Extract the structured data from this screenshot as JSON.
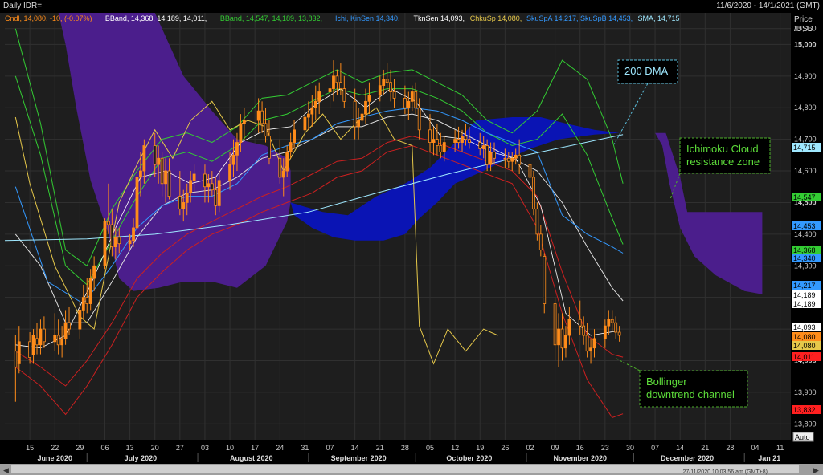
{
  "header": {
    "title": "Daily IDR=",
    "date_range": "11/6/2020 - 14/1/2021 (GMT)"
  },
  "legend": [
    {
      "text": "Cndl, 14,080, -10, (-0.07%)",
      "color": "#ff8c1a"
    },
    {
      "text": "BBand, 14,368, 14,189, 14,011, ",
      "color": "#ffffff"
    },
    {
      "text": "BBand, 14,547, 14,189, 13,832, ",
      "color": "#33cc33"
    },
    {
      "text": "Ichi, KinSen 14,340, ",
      "color": "#3399ff"
    },
    {
      "text": "TknSen 14,093, ",
      "color": "#ffffff"
    },
    {
      "text": "ChkuSp 14,080, ",
      "color": "#e6c84a"
    },
    {
      "text": "SkuSpA 14,217, SkuSpB 14,453, ",
      "color": "#3399ff"
    },
    {
      "text": "SMA, 14,715",
      "color": "#9fe8ff"
    }
  ],
  "price_axis": {
    "title_line1": "Price",
    "title_line2": "/USD",
    "auto_label": "Auto"
  },
  "footer": {
    "timestamp": "27/11/2020 10:03:56 am (GMT+8)"
  },
  "annotations": [
    {
      "text_lines": [
        "200 DMA"
      ],
      "color": "#9fe8ff",
      "border": "#5bc0de"
    },
    {
      "text_lines": [
        "Ichimoku Cloud",
        "resistance zone"
      ],
      "color": "#5ddc3a",
      "border": "#4caf2a"
    },
    {
      "text_lines": [
        "Bollinger",
        "downtrend channel"
      ],
      "color": "#5ddc3a",
      "border": "#4caf2a"
    }
  ],
  "chart_data": {
    "type": "candlestick",
    "title": "Daily IDR=",
    "ylim": [
      13750,
      15100
    ],
    "ylabel": "Price /USD",
    "y_ticks": [
      13800,
      13900,
      14000,
      14100,
      14200,
      14300,
      14400,
      14500,
      14600,
      14700,
      14800,
      14900,
      15000,
      15050
    ],
    "y_tick_labels": [
      "13,800",
      "13,900",
      "14,000",
      "14,100",
      "14,200",
      "14,300",
      "14,400",
      "14,500",
      "14,600",
      "14,700",
      "14,800",
      "14,900",
      "15,000",
      "15,050"
    ],
    "y_bold_ticks": [
      14000,
      14500,
      15000
    ],
    "x_day_labels": [
      "15",
      "22",
      "29",
      "06",
      "13",
      "20",
      "27",
      "03",
      "10",
      "17",
      "24",
      "31",
      "07",
      "14",
      "21",
      "28",
      "05",
      "12",
      "19",
      "26",
      "02",
      "09",
      "16",
      "23",
      "30",
      "07",
      "14",
      "21",
      "28",
      "04",
      "11"
    ],
    "x_month_labels": [
      "June 2020",
      "July 2020",
      "August 2020",
      "September 2020",
      "October 2020",
      "November 2020",
      "December 2020",
      "Jan 21"
    ],
    "last_values": [
      {
        "label": "14,715",
        "value": 14715,
        "bg": "#9fe8ff",
        "fg": "#000000"
      },
      {
        "label": "14,547",
        "value": 14547,
        "bg": "#33cc33",
        "fg": "#000000"
      },
      {
        "label": "14,453",
        "value": 14453,
        "bg": "#3399ff",
        "fg": "#000000"
      },
      {
        "label": "14,368",
        "value": 14368,
        "bg": "#33cc33",
        "fg": "#000000"
      },
      {
        "label": "14,340",
        "value": 14340,
        "bg": "#3399ff",
        "fg": "#000000"
      },
      {
        "label": "14,217",
        "value": 14217,
        "bg": "#3399ff",
        "fg": "#000000"
      },
      {
        "label": "14,189",
        "value": 14189,
        "bg": "#ffffff",
        "fg": "#000000"
      },
      {
        "label": "14,189",
        "value": 14189,
        "bg": "#ffffff",
        "fg": "#000000"
      },
      {
        "label": "14,093",
        "value": 14093,
        "bg": "#ffffff",
        "fg": "#000000"
      },
      {
        "label": "14,080",
        "value": 14080,
        "bg": "#ff8c1a",
        "fg": "#000000"
      },
      {
        "label": "14,080",
        "value": 14080,
        "bg": "#e6c84a",
        "fg": "#000000"
      },
      {
        "label": "14,011",
        "value": 14011,
        "bg": "#ff2020",
        "fg": "#000000"
      },
      {
        "label": "13,832",
        "value": 13832,
        "bg": "#ff2020",
        "fg": "#000000"
      }
    ],
    "candles": [
      {
        "date": "2020-06-11",
        "o": 14030,
        "h": 14080,
        "l": 13870,
        "c": 13980
      },
      {
        "date": "2020-06-12",
        "o": 13990,
        "h": 14110,
        "l": 13960,
        "c": 14060
      },
      {
        "date": "2020-06-15",
        "o": 14060,
        "h": 14090,
        "l": 13990,
        "c": 14010
      },
      {
        "date": "2020-06-16",
        "o": 14020,
        "h": 14100,
        "l": 13990,
        "c": 14080
      },
      {
        "date": "2020-06-17",
        "o": 14070,
        "h": 14120,
        "l": 14020,
        "c": 14050
      },
      {
        "date": "2020-06-18",
        "o": 14050,
        "h": 14130,
        "l": 14020,
        "c": 14100
      },
      {
        "date": "2020-06-19",
        "o": 14100,
        "h": 14140,
        "l": 14040,
        "c": 14060
      },
      {
        "date": "2020-06-22",
        "o": 14060,
        "h": 14150,
        "l": 14030,
        "c": 14080
      },
      {
        "date": "2020-06-23",
        "o": 14080,
        "h": 14130,
        "l": 14020,
        "c": 14050
      },
      {
        "date": "2020-06-24",
        "o": 14050,
        "h": 14110,
        "l": 14010,
        "c": 14070
      },
      {
        "date": "2020-06-25",
        "o": 14070,
        "h": 14160,
        "l": 14050,
        "c": 14120
      },
      {
        "date": "2020-06-26",
        "o": 14120,
        "h": 14170,
        "l": 14080,
        "c": 14100
      },
      {
        "date": "2020-06-29",
        "o": 14100,
        "h": 14190,
        "l": 14070,
        "c": 14160
      },
      {
        "date": "2020-06-30",
        "o": 14160,
        "h": 14240,
        "l": 14130,
        "c": 14200
      },
      {
        "date": "2020-07-01",
        "o": 14200,
        "h": 14260,
        "l": 14150,
        "c": 14180
      },
      {
        "date": "2020-07-02",
        "o": 14180,
        "h": 14290,
        "l": 14160,
        "c": 14260
      },
      {
        "date": "2020-07-03",
        "o": 14260,
        "h": 14330,
        "l": 14220,
        "c": 14300
      },
      {
        "date": "2020-07-06",
        "o": 14300,
        "h": 14450,
        "l": 14290,
        "c": 14440
      },
      {
        "date": "2020-07-07",
        "o": 14440,
        "h": 14560,
        "l": 14400,
        "c": 14430
      },
      {
        "date": "2020-07-08",
        "o": 14430,
        "h": 14480,
        "l": 14330,
        "c": 14360
      },
      {
        "date": "2020-07-09",
        "o": 14360,
        "h": 14420,
        "l": 14320,
        "c": 14390
      },
      {
        "date": "2020-07-10",
        "o": 14390,
        "h": 14420,
        "l": 14340,
        "c": 14370
      },
      {
        "date": "2020-07-13",
        "o": 14370,
        "h": 14400,
        "l": 14350,
        "c": 14380
      },
      {
        "date": "2020-07-14",
        "o": 14380,
        "h": 14450,
        "l": 14360,
        "c": 14420
      },
      {
        "date": "2020-07-15",
        "o": 14420,
        "h": 14600,
        "l": 14400,
        "c": 14580
      },
      {
        "date": "2020-07-16",
        "o": 14580,
        "h": 14660,
        "l": 14520,
        "c": 14600
      },
      {
        "date": "2020-07-17",
        "o": 14600,
        "h": 14700,
        "l": 14560,
        "c": 14680
      },
      {
        "date": "2020-07-20",
        "o": 14680,
        "h": 14720,
        "l": 14580,
        "c": 14620
      },
      {
        "date": "2020-07-21",
        "o": 14620,
        "h": 14680,
        "l": 14560,
        "c": 14640
      },
      {
        "date": "2020-07-22",
        "o": 14640,
        "h": 14660,
        "l": 14520,
        "c": 14560
      },
      {
        "date": "2020-07-23",
        "o": 14560,
        "h": 14640,
        "l": 14500,
        "c": 14600
      },
      {
        "date": "2020-07-24",
        "o": 14600,
        "h": 14640,
        "l": 14510,
        "c": 14520
      },
      {
        "date": "2020-07-27",
        "o": 14520,
        "h": 14600,
        "l": 14460,
        "c": 14480
      },
      {
        "date": "2020-07-28",
        "o": 14480,
        "h": 14540,
        "l": 14440,
        "c": 14500
      },
      {
        "date": "2020-07-29",
        "o": 14500,
        "h": 14560,
        "l": 14460,
        "c": 14530
      },
      {
        "date": "2020-07-30",
        "o": 14530,
        "h": 14600,
        "l": 14500,
        "c": 14570
      },
      {
        "date": "2020-07-31",
        "o": 14570,
        "h": 14620,
        "l": 14530,
        "c": 14590
      },
      {
        "date": "2020-08-03",
        "o": 14590,
        "h": 14620,
        "l": 14500,
        "c": 14550
      },
      {
        "date": "2020-08-04",
        "o": 14550,
        "h": 14590,
        "l": 14500,
        "c": 14560
      },
      {
        "date": "2020-08-05",
        "o": 14560,
        "h": 14600,
        "l": 14520,
        "c": 14540
      },
      {
        "date": "2020-08-06",
        "o": 14540,
        "h": 14580,
        "l": 14460,
        "c": 14490
      },
      {
        "date": "2020-08-07",
        "o": 14490,
        "h": 14600,
        "l": 14470,
        "c": 14570
      },
      {
        "date": "2020-08-10",
        "o": 14570,
        "h": 14660,
        "l": 14540,
        "c": 14620
      },
      {
        "date": "2020-08-11",
        "o": 14620,
        "h": 14700,
        "l": 14580,
        "c": 14650
      },
      {
        "date": "2020-08-12",
        "o": 14650,
        "h": 14720,
        "l": 14600,
        "c": 14690
      },
      {
        "date": "2020-08-13",
        "o": 14690,
        "h": 14780,
        "l": 14660,
        "c": 14750
      },
      {
        "date": "2020-08-14",
        "o": 14750,
        "h": 14800,
        "l": 14700,
        "c": 14760
      },
      {
        "date": "2020-08-18",
        "o": 14760,
        "h": 14830,
        "l": 14720,
        "c": 14790
      },
      {
        "date": "2020-08-19",
        "o": 14790,
        "h": 14820,
        "l": 14720,
        "c": 14750
      },
      {
        "date": "2020-08-20",
        "o": 14750,
        "h": 14800,
        "l": 14690,
        "c": 14710
      },
      {
        "date": "2020-08-21",
        "o": 14710,
        "h": 14760,
        "l": 14620,
        "c": 14640
      },
      {
        "date": "2020-08-24",
        "o": 14640,
        "h": 14700,
        "l": 14560,
        "c": 14580
      },
      {
        "date": "2020-08-25",
        "o": 14580,
        "h": 14640,
        "l": 14520,
        "c": 14600
      },
      {
        "date": "2020-08-26",
        "o": 14600,
        "h": 14680,
        "l": 14580,
        "c": 14660
      },
      {
        "date": "2020-08-27",
        "o": 14660,
        "h": 14720,
        "l": 14640,
        "c": 14690
      },
      {
        "date": "2020-08-28",
        "o": 14690,
        "h": 14760,
        "l": 14670,
        "c": 14730
      },
      {
        "date": "2020-08-31",
        "o": 14730,
        "h": 14800,
        "l": 14700,
        "c": 14770
      },
      {
        "date": "2020-09-01",
        "o": 14770,
        "h": 14820,
        "l": 14730,
        "c": 14780
      },
      {
        "date": "2020-09-02",
        "o": 14780,
        "h": 14840,
        "l": 14740,
        "c": 14800
      },
      {
        "date": "2020-09-03",
        "o": 14800,
        "h": 14870,
        "l": 14760,
        "c": 14820
      },
      {
        "date": "2020-09-04",
        "o": 14820,
        "h": 14880,
        "l": 14780,
        "c": 14850
      },
      {
        "date": "2020-09-07",
        "o": 14850,
        "h": 14900,
        "l": 14800,
        "c": 14860
      },
      {
        "date": "2020-09-08",
        "o": 14860,
        "h": 14950,
        "l": 14820,
        "c": 14900
      },
      {
        "date": "2020-09-09",
        "o": 14900,
        "h": 14920,
        "l": 14840,
        "c": 14880
      },
      {
        "date": "2020-09-10",
        "o": 14880,
        "h": 14940,
        "l": 14840,
        "c": 14860
      },
      {
        "date": "2020-09-11",
        "o": 14860,
        "h": 14900,
        "l": 14800,
        "c": 14820
      },
      {
        "date": "2020-09-14",
        "o": 14820,
        "h": 14860,
        "l": 14700,
        "c": 14740
      },
      {
        "date": "2020-09-15",
        "o": 14740,
        "h": 14800,
        "l": 14700,
        "c": 14760
      },
      {
        "date": "2020-09-16",
        "o": 14760,
        "h": 14820,
        "l": 14730,
        "c": 14780
      },
      {
        "date": "2020-09-17",
        "o": 14780,
        "h": 14860,
        "l": 14750,
        "c": 14820
      },
      {
        "date": "2020-09-18",
        "o": 14820,
        "h": 14880,
        "l": 14780,
        "c": 14840
      },
      {
        "date": "2020-09-21",
        "o": 14840,
        "h": 14900,
        "l": 14820,
        "c": 14870
      },
      {
        "date": "2020-09-22",
        "o": 14870,
        "h": 14920,
        "l": 14840,
        "c": 14890
      },
      {
        "date": "2020-09-23",
        "o": 14890,
        "h": 14940,
        "l": 14850,
        "c": 14880
      },
      {
        "date": "2020-09-24",
        "o": 14880,
        "h": 14920,
        "l": 14820,
        "c": 14850
      },
      {
        "date": "2020-09-25",
        "o": 14850,
        "h": 14890,
        "l": 14800,
        "c": 14830
      },
      {
        "date": "2020-09-28",
        "o": 14830,
        "h": 14870,
        "l": 14780,
        "c": 14800
      },
      {
        "date": "2020-09-29",
        "o": 14800,
        "h": 14850,
        "l": 14760,
        "c": 14820
      },
      {
        "date": "2020-09-30",
        "o": 14820,
        "h": 14870,
        "l": 14790,
        "c": 14850
      },
      {
        "date": "2020-10-01",
        "o": 14850,
        "h": 14880,
        "l": 14780,
        "c": 14800
      },
      {
        "date": "2020-10-02",
        "o": 14800,
        "h": 14830,
        "l": 14700,
        "c": 14730
      },
      {
        "date": "2020-10-05",
        "o": 14730,
        "h": 14780,
        "l": 14660,
        "c": 14690
      },
      {
        "date": "2020-10-06",
        "o": 14690,
        "h": 14740,
        "l": 14650,
        "c": 14700
      },
      {
        "date": "2020-10-07",
        "o": 14700,
        "h": 14750,
        "l": 14650,
        "c": 14680
      },
      {
        "date": "2020-10-08",
        "o": 14680,
        "h": 14720,
        "l": 14640,
        "c": 14660
      },
      {
        "date": "2020-10-09",
        "o": 14660,
        "h": 14710,
        "l": 14630,
        "c": 14690
      },
      {
        "date": "2020-10-12",
        "o": 14690,
        "h": 14730,
        "l": 14660,
        "c": 14700
      },
      {
        "date": "2020-10-13",
        "o": 14700,
        "h": 14740,
        "l": 14670,
        "c": 14690
      },
      {
        "date": "2020-10-14",
        "o": 14690,
        "h": 14730,
        "l": 14660,
        "c": 14710
      },
      {
        "date": "2020-10-15",
        "o": 14710,
        "h": 14750,
        "l": 14680,
        "c": 14700
      },
      {
        "date": "2020-10-16",
        "o": 14700,
        "h": 14740,
        "l": 14670,
        "c": 14690
      },
      {
        "date": "2020-10-19",
        "o": 14690,
        "h": 14720,
        "l": 14650,
        "c": 14670
      },
      {
        "date": "2020-10-20",
        "o": 14670,
        "h": 14710,
        "l": 14640,
        "c": 14680
      },
      {
        "date": "2020-10-21",
        "o": 14680,
        "h": 14700,
        "l": 14600,
        "c": 14620
      },
      {
        "date": "2020-10-22",
        "o": 14620,
        "h": 14690,
        "l": 14600,
        "c": 14660
      },
      {
        "date": "2020-10-23",
        "o": 14660,
        "h": 14690,
        "l": 14620,
        "c": 14640
      },
      {
        "date": "2020-10-26",
        "o": 14640,
        "h": 14670,
        "l": 14610,
        "c": 14640
      },
      {
        "date": "2020-10-27",
        "o": 14640,
        "h": 14660,
        "l": 14610,
        "c": 14630
      },
      {
        "date": "2020-10-28",
        "o": 14630,
        "h": 14660,
        "l": 14600,
        "c": 14640
      },
      {
        "date": "2020-10-29",
        "o": 14640,
        "h": 14670,
        "l": 14620,
        "c": 14650
      },
      {
        "date": "2020-10-30",
        "o": 14650,
        "h": 14700,
        "l": 14590,
        "c": 14620
      },
      {
        "date": "2020-11-02",
        "o": 14620,
        "h": 14640,
        "l": 14560,
        "c": 14580
      },
      {
        "date": "2020-11-03",
        "o": 14580,
        "h": 14600,
        "l": 14460,
        "c": 14480
      },
      {
        "date": "2020-11-04",
        "o": 14480,
        "h": 14500,
        "l": 14380,
        "c": 14400
      },
      {
        "date": "2020-11-05",
        "o": 14400,
        "h": 14430,
        "l": 14330,
        "c": 14350
      },
      {
        "date": "2020-11-06",
        "o": 14330,
        "h": 14340,
        "l": 14150,
        "c": 14180
      },
      {
        "date": "2020-11-09",
        "o": 14180,
        "h": 14200,
        "l": 14000,
        "c": 14050
      },
      {
        "date": "2020-11-10",
        "o": 14050,
        "h": 14150,
        "l": 13980,
        "c": 14100
      },
      {
        "date": "2020-11-11",
        "o": 14100,
        "h": 14150,
        "l": 14000,
        "c": 14040
      },
      {
        "date": "2020-11-12",
        "o": 14040,
        "h": 14110,
        "l": 14010,
        "c": 14080
      },
      {
        "date": "2020-11-13",
        "o": 14080,
        "h": 14170,
        "l": 14050,
        "c": 14130
      },
      {
        "date": "2020-11-16",
        "o": 14130,
        "h": 14190,
        "l": 14080,
        "c": 14110
      },
      {
        "date": "2020-11-17",
        "o": 14110,
        "h": 14140,
        "l": 14050,
        "c": 14080
      },
      {
        "date": "2020-11-18",
        "o": 14080,
        "h": 14120,
        "l": 14010,
        "c": 14030
      },
      {
        "date": "2020-11-19",
        "o": 14030,
        "h": 14070,
        "l": 13990,
        "c": 14040
      },
      {
        "date": "2020-11-20",
        "o": 14040,
        "h": 14100,
        "l": 14010,
        "c": 14070
      },
      {
        "date": "2020-11-23",
        "o": 14070,
        "h": 14130,
        "l": 14040,
        "c": 14110
      },
      {
        "date": "2020-11-24",
        "o": 14110,
        "h": 14160,
        "l": 14080,
        "c": 14130
      },
      {
        "date": "2020-11-25",
        "o": 14130,
        "h": 14160,
        "l": 14090,
        "c": 14120
      },
      {
        "date": "2020-11-26",
        "o": 14120,
        "h": 14140,
        "l": 14070,
        "c": 14090
      },
      {
        "date": "2020-11-27",
        "o": 14090,
        "h": 14110,
        "l": 14060,
        "c": 14080
      }
    ]
  }
}
